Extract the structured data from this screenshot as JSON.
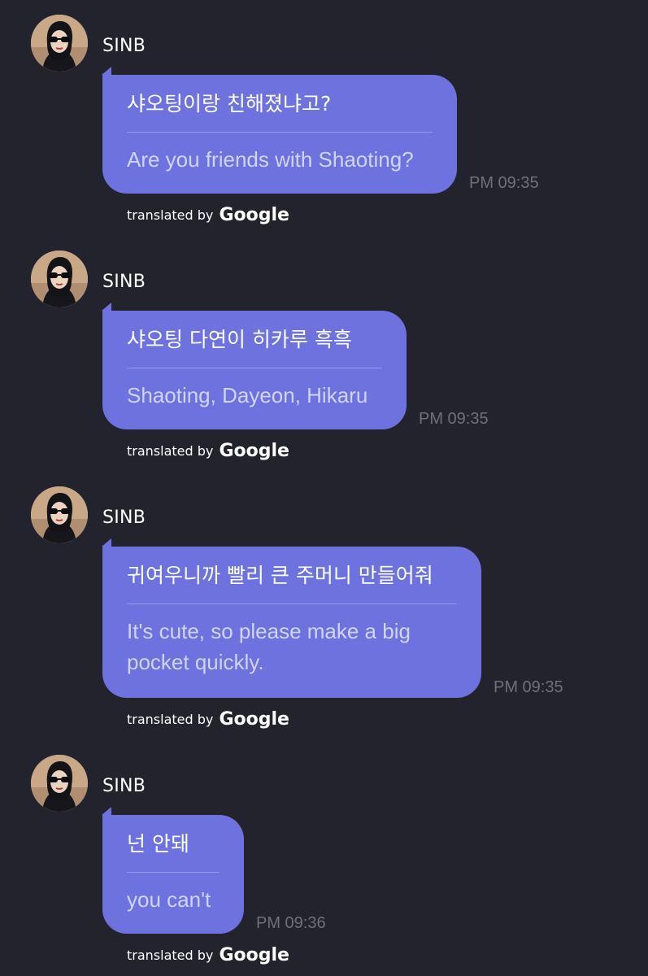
{
  "chat": {
    "messages": [
      {
        "sender": "SINB",
        "original": "샤오팅이랑 친해졌냐고?",
        "translated": "Are you friends with Shaoting?",
        "time": "PM 09:35",
        "credit_prefix": "translated by",
        "credit_brand": "Google"
      },
      {
        "sender": "SINB",
        "original": "샤오팅 다연이 히카루 흑흑",
        "translated": "Shaoting, Dayeon, Hikaru",
        "time": "PM 09:35",
        "credit_prefix": "translated by",
        "credit_brand": "Google"
      },
      {
        "sender": "SINB",
        "original": "귀여우니까 빨리 큰 주머니 만들어줘",
        "translated": "It's cute, so please make a big pocket quickly.",
        "time": "PM 09:35",
        "credit_prefix": "translated by",
        "credit_brand": "Google"
      },
      {
        "sender": "SINB",
        "original": "넌 안돼",
        "translated": "you can't",
        "time": "PM 09:36",
        "credit_prefix": "translated by",
        "credit_brand": "Google"
      }
    ]
  },
  "colors": {
    "background": "#22232c",
    "bubble": "#6e72de",
    "timestamp": "#6e707a"
  },
  "icons": {
    "avatar": "profile-photo"
  }
}
